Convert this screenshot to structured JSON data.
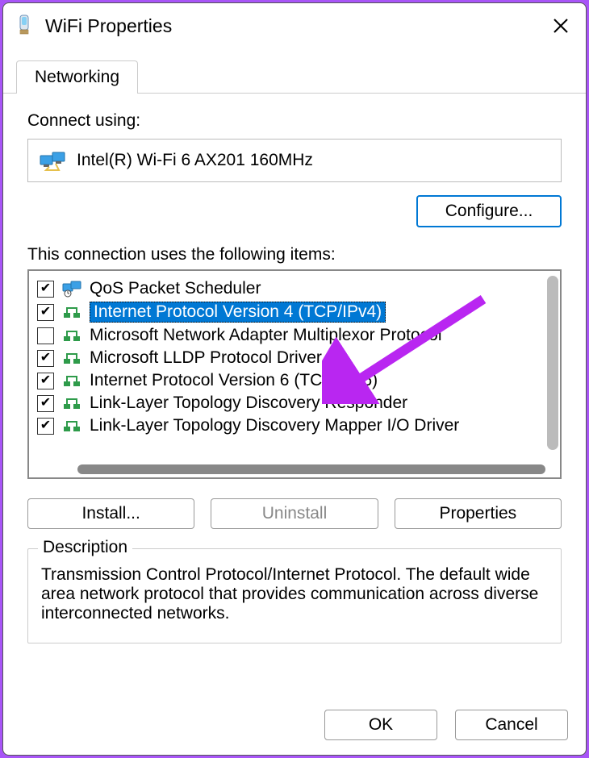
{
  "window": {
    "title": "WiFi Properties"
  },
  "tabs": [
    {
      "label": "Networking"
    }
  ],
  "connect_using_label": "Connect using:",
  "adapter_name": "Intel(R) Wi-Fi 6 AX201 160MHz",
  "configure_label": "Configure...",
  "items_label": "This connection uses the following items:",
  "items": [
    {
      "checked": true,
      "selected": false,
      "icon": "qos",
      "label": "QoS Packet Scheduler"
    },
    {
      "checked": true,
      "selected": true,
      "icon": "proto",
      "label": "Internet Protocol Version 4 (TCP/IPv4)"
    },
    {
      "checked": false,
      "selected": false,
      "icon": "proto",
      "label": "Microsoft Network Adapter Multiplexor Protocol"
    },
    {
      "checked": true,
      "selected": false,
      "icon": "proto",
      "label": "Microsoft LLDP Protocol Driver"
    },
    {
      "checked": true,
      "selected": false,
      "icon": "proto",
      "label": "Internet Protocol Version 6 (TCP/IPv6)"
    },
    {
      "checked": true,
      "selected": false,
      "icon": "proto",
      "label": "Link-Layer Topology Discovery Responder"
    },
    {
      "checked": true,
      "selected": false,
      "icon": "proto",
      "label": "Link-Layer Topology Discovery Mapper I/O Driver"
    }
  ],
  "buttons": {
    "install": "Install...",
    "uninstall": "Uninstall",
    "properties": "Properties",
    "ok": "OK",
    "cancel": "Cancel"
  },
  "description": {
    "legend": "Description",
    "text": "Transmission Control Protocol/Internet Protocol. The default wide area network protocol that provides communication across diverse interconnected networks."
  },
  "annotation": {
    "arrow_color": "#b926f1"
  }
}
